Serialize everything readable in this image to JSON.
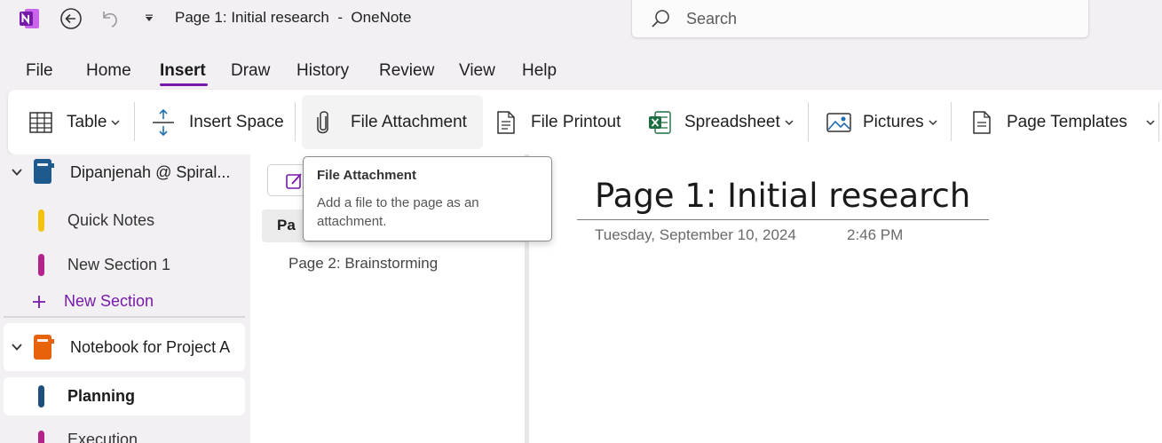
{
  "titlebar": {
    "title": "Page 1: Initial research  -  OneNote",
    "search_placeholder": "Search",
    "colors": {
      "brand": "#7719aa"
    }
  },
  "menu": {
    "items": [
      {
        "label": "File",
        "key": "file"
      },
      {
        "label": "Home",
        "key": "home"
      },
      {
        "label": "Insert",
        "key": "insert",
        "active": true
      },
      {
        "label": "Draw",
        "key": "draw"
      },
      {
        "label": "History",
        "key": "history"
      },
      {
        "label": "Review",
        "key": "review"
      },
      {
        "label": "View",
        "key": "view"
      },
      {
        "label": "Help",
        "key": "help"
      }
    ]
  },
  "ribbon": {
    "table": "Table",
    "insert_space": "Insert Space",
    "file_attachment": "File Attachment",
    "file_printout": "File Printout",
    "spreadsheet": "Spreadsheet",
    "pictures": "Pictures",
    "page_templates": "Page Templates"
  },
  "tooltip": {
    "title": "File Attachment",
    "description": "Add a file to the page as an attachment."
  },
  "nav": {
    "notebook1": {
      "name": "Dipanjenah @ Spiral...",
      "color": "#1e5a8e"
    },
    "sections1": [
      {
        "label": "Quick Notes",
        "color": "#f4c20d"
      },
      {
        "label": "New Section 1",
        "color": "#b4228c"
      }
    ],
    "new_section": "New Section",
    "notebook2": {
      "name": "Notebook for Project A",
      "color": "#e8620c"
    },
    "sections2": [
      {
        "label": "Planning",
        "color": "#1e4f7a",
        "selected": true
      },
      {
        "label": "Execution",
        "color": "#b4228c"
      }
    ]
  },
  "pages": {
    "selected_partial": "Pa",
    "items": [
      "Page 2: Brainstorming"
    ]
  },
  "canvas": {
    "title": "Page 1: Initial research",
    "date": "Tuesday, September 10, 2024",
    "time": "2:46 PM"
  }
}
